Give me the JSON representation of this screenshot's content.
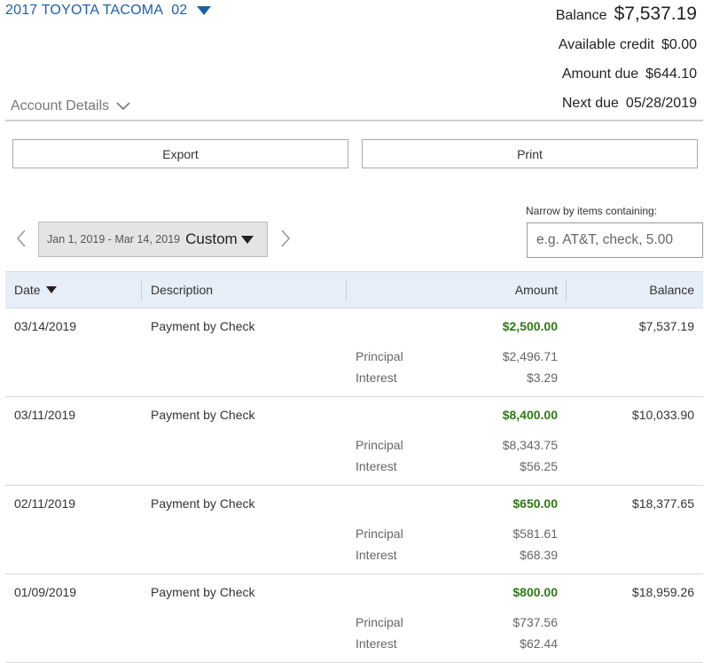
{
  "account": {
    "name": "2017 TOYOTA TACOMA",
    "number": "02",
    "details_label": "Account Details"
  },
  "summary": {
    "balance_label": "Balance",
    "balance_value": "$7,537.19",
    "available_credit_label": "Available credit",
    "available_credit_value": "$0.00",
    "amount_due_label": "Amount due",
    "amount_due_value": "$644.10",
    "next_due_label": "Next due",
    "next_due_value": "05/28/2019"
  },
  "toolbar": {
    "export_label": "Export",
    "print_label": "Print"
  },
  "filter": {
    "date_range": "Jan 1, 2019 - Mar 14, 2019",
    "range_type": "Custom",
    "narrow_label": "Narrow by items containing:",
    "search_placeholder": "e.g. AT&T, check, 5.00",
    "search_value": ""
  },
  "table": {
    "headers": {
      "date": "Date",
      "description": "Description",
      "amount": "Amount",
      "balance": "Balance"
    },
    "rows": [
      {
        "date": "03/14/2019",
        "description": "Payment by Check",
        "amount": "$2,500.00",
        "balance": "$7,537.19",
        "principal_label": "Principal",
        "principal": "$2,496.71",
        "interest_label": "Interest",
        "interest": "$3.29"
      },
      {
        "date": "03/11/2019",
        "description": "Payment by Check",
        "amount": "$8,400.00",
        "balance": "$10,033.90",
        "principal_label": "Principal",
        "principal": "$8,343.75",
        "interest_label": "Interest",
        "interest": "$56.25"
      },
      {
        "date": "02/11/2019",
        "description": "Payment by Check",
        "amount": "$650.00",
        "balance": "$18,377.65",
        "principal_label": "Principal",
        "principal": "$581.61",
        "interest_label": "Interest",
        "interest": "$68.39"
      },
      {
        "date": "01/09/2019",
        "description": "Payment by Check",
        "amount": "$800.00",
        "balance": "$18,959.26",
        "principal_label": "Principal",
        "principal": "$737.56",
        "interest_label": "Interest",
        "interest": "$62.44"
      }
    ]
  },
  "colors": {
    "link_blue": "#1f5fa8",
    "amount_green": "#2f7a16",
    "header_bg": "#e7eef7"
  },
  "icons": {
    "account_dropdown": "caret-down-icon",
    "details_toggle": "chevron-down-icon",
    "prev": "chevron-left-icon",
    "next": "chevron-right-icon",
    "sort": "caret-down-icon"
  }
}
